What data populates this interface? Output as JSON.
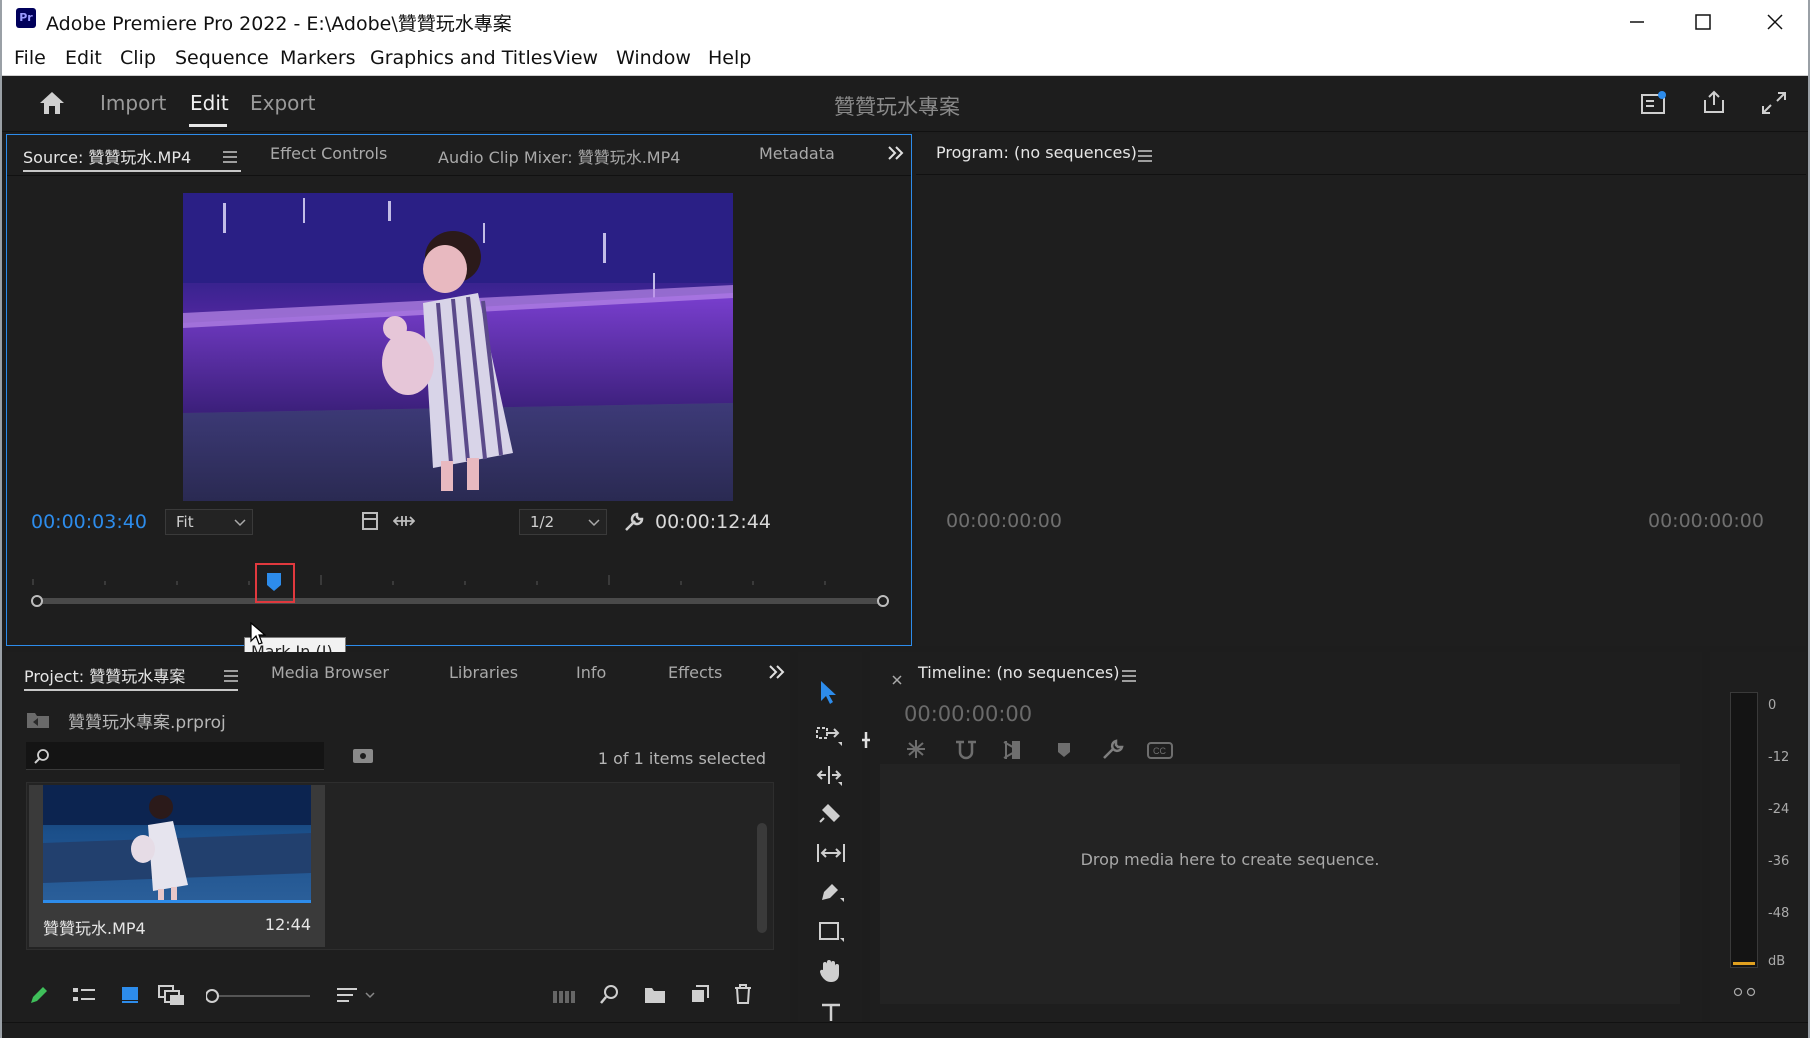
{
  "window": {
    "app_badge": "Pr",
    "title": "Adobe Premiere Pro 2022 - E:\\Adobe\\贊贊玩水專案",
    "controls": [
      "minimize",
      "maximize",
      "close"
    ]
  },
  "menu": [
    "File",
    "Edit",
    "Clip",
    "Sequence",
    "Markers",
    "Graphics and Titles",
    "View",
    "Window",
    "Help"
  ],
  "workspace": {
    "tabs": [
      {
        "label": "Import",
        "active": false
      },
      {
        "label": "Edit",
        "active": true
      },
      {
        "label": "Export",
        "active": false
      }
    ],
    "project_name": "贊贊玩水專案"
  },
  "source_panel": {
    "tabs": [
      "Source: 贊贊玩水.MP4",
      "Effect Controls",
      "Audio Clip Mixer: 贊贊玩水.MP4",
      "Metadata"
    ],
    "current_time": "00:00:03:40",
    "zoom": "Fit",
    "resolution": "1/2",
    "duration": "00:00:12:44",
    "playhead_fraction": 0.28
  },
  "program_panel": {
    "title": "Program: (no sequences)",
    "current_time": "00:00:00:00",
    "duration": "00:00:00:00"
  },
  "tooltip": "Mark In (I)",
  "project_panel": {
    "tabs": [
      "Project: 贊贊玩水專案",
      "Media Browser",
      "Libraries",
      "Info",
      "Effects"
    ],
    "file": "贊贊玩水專案.prproj",
    "selection_status": "1 of 1 items selected",
    "search_placeholder": "",
    "item": {
      "name": "贊贊玩水.MP4",
      "duration": "12:44"
    }
  },
  "timeline_panel": {
    "title": "Timeline: (no sequences)",
    "timecode": "00:00:00:00",
    "empty_message": "Drop media here to create sequence."
  },
  "audio_meter": {
    "labels": [
      "0",
      "-12",
      "-24",
      "-36",
      "-48",
      "dB"
    ]
  },
  "colors": {
    "accent": "#2d8ceb",
    "panel": "#1e1e1e",
    "highlight": "#e0393e"
  }
}
